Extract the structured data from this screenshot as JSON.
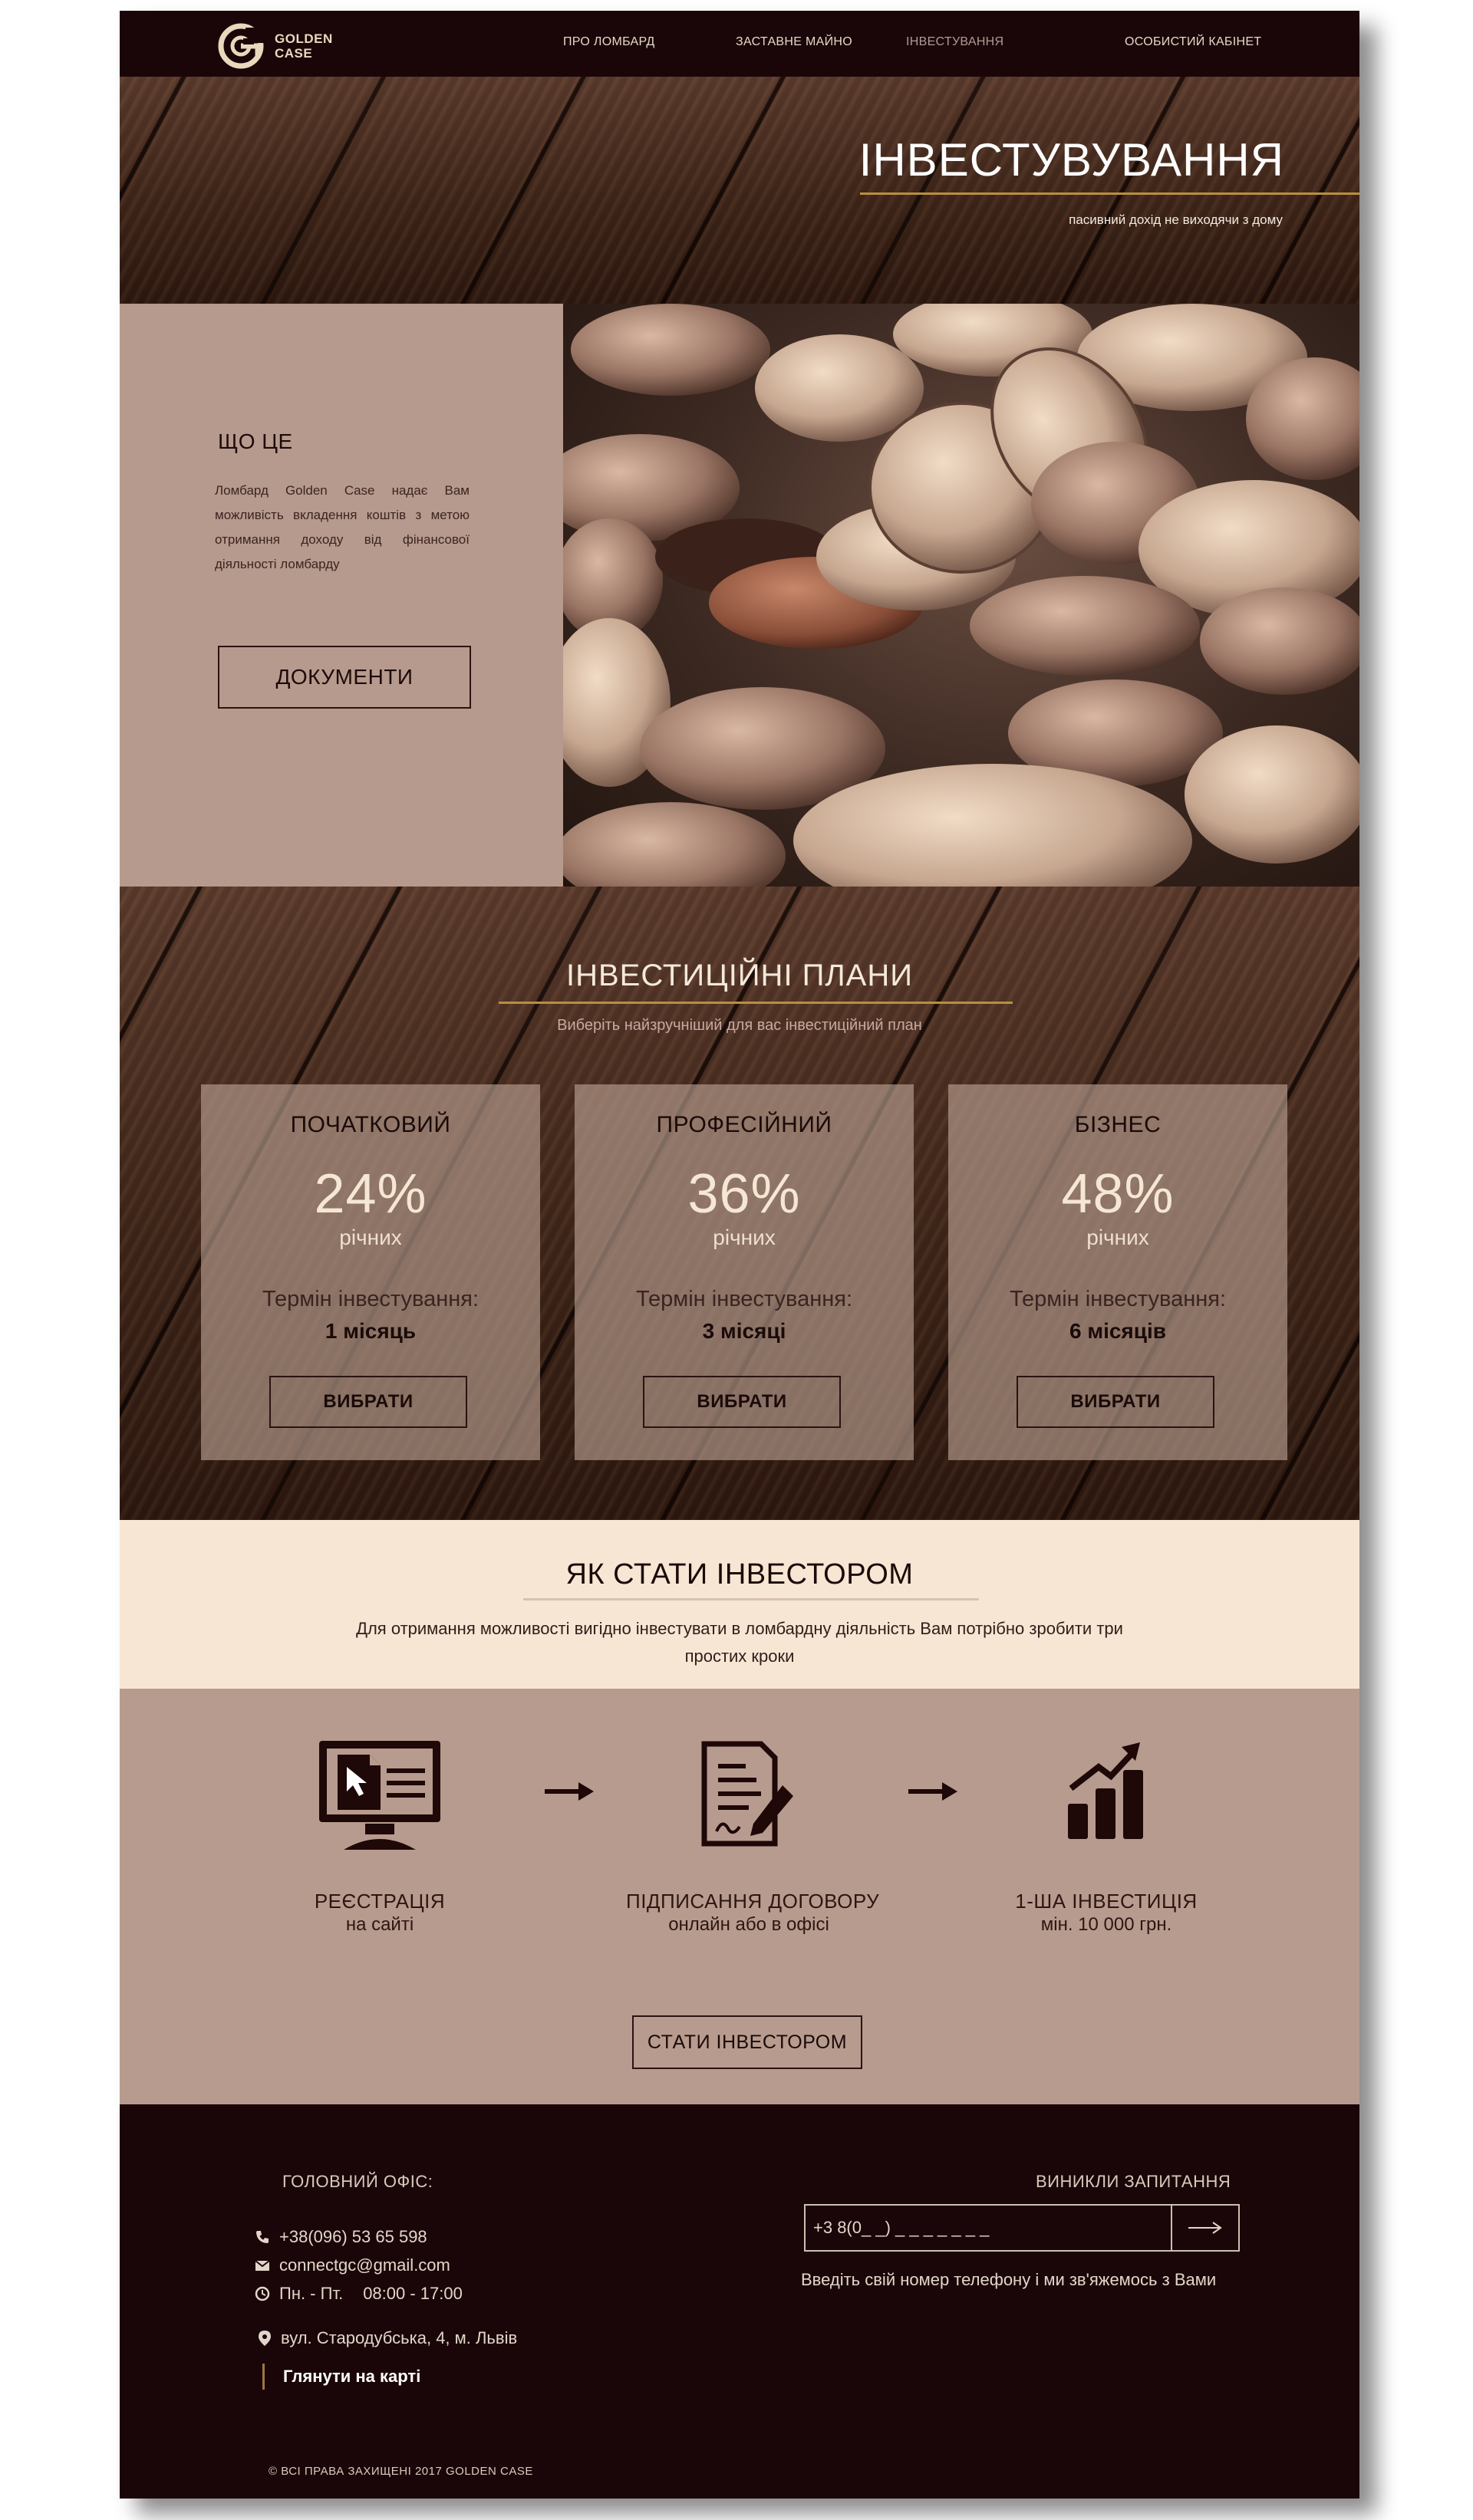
{
  "nav": {
    "logo_line1": "GOLDEN",
    "logo_line2": "CASE",
    "items": [
      "ПРО ЛОМБАРД",
      "ЗАСТАВНЕ МАЙНО",
      "ІНВЕСТУВАННЯ",
      "ОСОБИСТИЙ КАБІНЕТ"
    ],
    "active": "ІНВЕСТУВАННЯ"
  },
  "hero": {
    "title": "ІНВЕСТУВУВАННЯ",
    "subtitle": "пасивний дохід не виходячи з дому"
  },
  "about": {
    "title": "ЩО ЦЕ",
    "text": "Ломбард Golden Case надає Вам можливість вкладення коштів з метою отримання доходу від фінансової діяльності ломбарду",
    "button": "ДОКУМЕНТИ"
  },
  "plans": {
    "title": "ІНВЕСТИЦІЙНІ ПЛАНИ",
    "subtitle": "Виберіть найзручніший для вас інвестиційний план",
    "cards": [
      {
        "name": "ПОЧАТКОВИЙ",
        "percent": "24%",
        "period": "річних",
        "term_label": "Термін інвестування:",
        "term": "1 місяць",
        "button": "ВИБРАТИ"
      },
      {
        "name": "ПРОФЕСІЙНИЙ",
        "percent": "36%",
        "period": "річних",
        "term_label": "Термін інвестування:",
        "term": "3 місяці",
        "button": "ВИБРАТИ"
      },
      {
        "name": "БІЗНЕС",
        "percent": "48%",
        "period": "річних",
        "term_label": "Термін інвестування:",
        "term": "6 місяців",
        "button": "ВИБРАТИ"
      }
    ]
  },
  "howto": {
    "title": "ЯК СТАТИ ІНВЕСТОРОМ",
    "text": "Для отримання можливості вигідно інвестувати в ломбардну діяльність Вам потрібно зробити три простих кроки",
    "steps": [
      {
        "icon": "computer-registration-icon",
        "line1": "РЕЄСТРАЦІЯ",
        "line2": "на сайті"
      },
      {
        "icon": "contract-sign-icon",
        "line1": "ПІДПИСАННЯ ДОГОВОРУ",
        "line2": "онлайн або в офісі"
      },
      {
        "icon": "growth-chart-icon",
        "line1": "1-ША ІНВЕСТИЦІЯ",
        "line2": "мін. 10 000 грн."
      }
    ],
    "button": "СТАТИ ІНВЕСТОРОМ"
  },
  "footer": {
    "office_title": "ГОЛОВНИЙ ОФІС:",
    "phone": "+38(096) 53 65 598",
    "email": "connectgc@gmail.com",
    "hours_days": "Пн. - Пт.",
    "hours_time": "08:00 - 17:00",
    "address": "вул. Стародубська, 4, м. Львів",
    "map_link": "Глянути на карті",
    "question_title": "ВИНИКЛИ ЗАПИТАННЯ",
    "phone_placeholder": "+3 8(0_ _) _ _ _ _ _ _ _",
    "note": "Введіть свій номер телефону і ми зв'яжемось з Вами",
    "copyright": "© ВСІ ПРАВА ЗАХИЩЕНІ 2017 GOLDEN CASE"
  },
  "colors": {
    "dark_bg": "#1a0608",
    "accent_gold": "#b8903f",
    "mauve": "#b69a8d",
    "cream": "#f8e6d4"
  }
}
